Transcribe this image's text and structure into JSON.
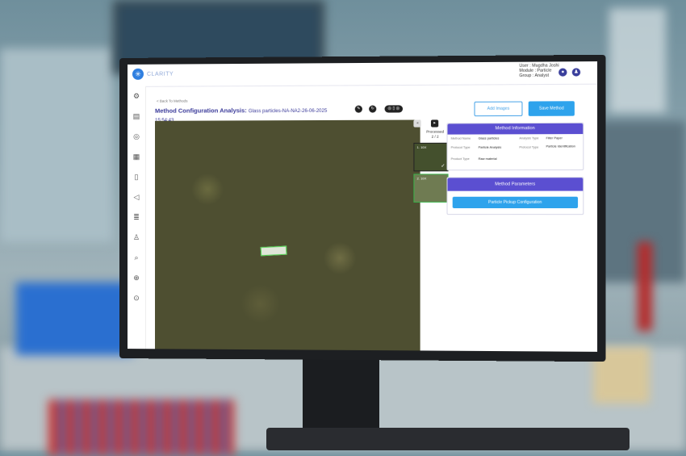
{
  "app": {
    "brand": "CLARITY",
    "logo_mark": "✳"
  },
  "user": {
    "user_line": "User : Mugdha Joshi",
    "module_line": "Module : Particle",
    "group_line": "Group : Analyst"
  },
  "nav": {
    "back_link": "< Back To Methods"
  },
  "page": {
    "title": "Method Configuration Analysis:",
    "title_detail": "Glass particles-NA-NA2-26-06-2025",
    "title_time": "15:54:43"
  },
  "toolbar": {
    "pill_label": "◎ ▯ ◎"
  },
  "actions": {
    "add_images": "Add Images",
    "save_method": "Save Method"
  },
  "thumbnails": {
    "processed_label": "Processed",
    "processed_count": "2 / 2",
    "items": [
      {
        "label": "1. 10X",
        "check": "✓"
      },
      {
        "label": "2. 10X"
      }
    ]
  },
  "method_information": {
    "header": "Method Information",
    "fields": {
      "method_name_label": "Method Name",
      "method_name": "Glass particles",
      "analysis_type_label": "Analysis Type",
      "analysis_type": "Filter Paper",
      "protocol_type_label": "Protocol Type",
      "protocol_type": "Particle Analysis",
      "protocol_type2_label": "Protocol Type",
      "protocol_type2": "Particle Identification",
      "product_type_label": "Product Type",
      "product_type": "Raw material"
    }
  },
  "method_parameters": {
    "header": "Method Parameters",
    "button": "Particle Pickup Configuration"
  },
  "colors": {
    "accent": "#5b4fd1",
    "button_blue": "#2ea3ec",
    "title": "#3b3b9a"
  }
}
